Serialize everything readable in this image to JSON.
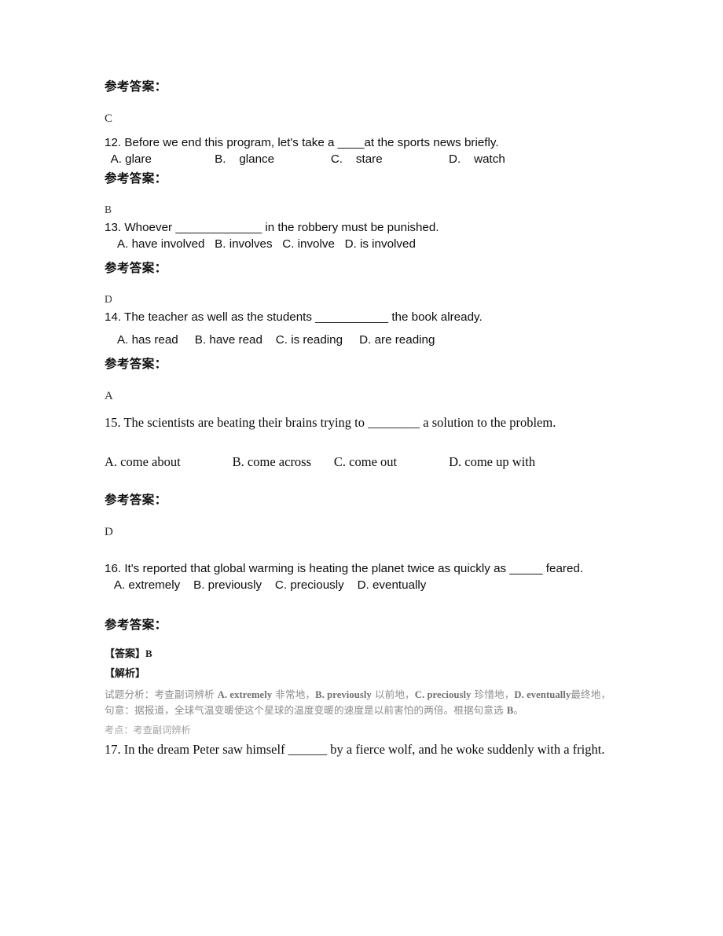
{
  "document": {
    "answer_heading": "参考答案：",
    "blocks": [
      {
        "kind": "answer_heading",
        "text": "参考答案："
      },
      {
        "kind": "answer_letter",
        "text": "C"
      },
      {
        "kind": "question_sans",
        "number": "12.",
        "text": "12. Before we end this program, let's take a ____at the sports news briefly.",
        "options": "  A. glare                   B.    glance                 C.    stare                    D.    watch"
      },
      {
        "kind": "answer_heading",
        "text": "参考答案："
      },
      {
        "kind": "answer_letter_small",
        "text": "B"
      },
      {
        "kind": "question_sans",
        "number": "13.",
        "text": "13. Whoever _____________ in the robbery must be punished.",
        "options": "    A. have involved   B. involves   C. involve   D. is involved"
      },
      {
        "kind": "answer_heading",
        "text": "参考答案："
      },
      {
        "kind": "answer_letter_small",
        "text": "D"
      },
      {
        "kind": "question_sans",
        "number": "14.",
        "text": "  14. The teacher as well as the students ___________ the book already.",
        "options": "    A. has read     B. have read    C. is reading     D. are reading"
      },
      {
        "kind": "answer_heading",
        "text": "参考答案："
      },
      {
        "kind": "answer_letter",
        "text": "A"
      },
      {
        "kind": "question_serif",
        "number": "15.",
        "text": "15. The scientists are beating their brains trying to ________ a solution to the problem.",
        "options": "A. come about                B. come across       C. come out                D. come up with"
      },
      {
        "kind": "answer_heading",
        "text": "参考答案："
      },
      {
        "kind": "answer_letter",
        "text": "D"
      },
      {
        "kind": "question_sans_justified",
        "number": "16.",
        "text": "16. It's reported that global warming is heating the planet twice as quickly as _____ feared.",
        "options": "   A. extremely    B. previously    C. preciously    D. eventually"
      },
      {
        "kind": "answer_heading",
        "text": "参考答案："
      },
      {
        "kind": "explanation_answer",
        "label": "【答案】",
        "value": "B"
      },
      {
        "kind": "explanation_label",
        "label": "【解析】"
      },
      {
        "kind": "explanation_body",
        "line1_pre": "试题分析：考查副词辨析 ",
        "line1_a": "A. extremely",
        "line1_a_cn": " 非常地，",
        "line1_b": "B. previously",
        "line1_b_cn": " 以前地，",
        "line1_c": "C. preciously",
        "line1_c_cn": " 珍惜地，",
        "line1_d": "D. eventually",
        "line2": "最终地，句意：据报道，全球气温变暖使这个星球的温度变暖的速度是以前害怕的两倍。根据句意选 ",
        "line2_end": "B",
        "line2_punct": "。"
      },
      {
        "kind": "explanation_point",
        "text": "考点：考查副词辨析"
      },
      {
        "kind": "question_serif_justified",
        "number": "17.",
        "text": "17. In the dream Peter saw himself ______ by a fierce wolf, and he woke suddenly with a fright."
      }
    ]
  },
  "q12": {
    "stem": "12. Before we end this program, let's take a ____at the sports news briefly.",
    "options": "  A. glare                   B.    glance                 C.    stare                    D.    watch"
  },
  "q13": {
    "stem": "13. Whoever _____________ in the robbery must be punished.",
    "options": "    A. have involved   B. involves   C. involve   D. is involved"
  },
  "q14": {
    "stem": "  14. The teacher as well as the students ___________ the book already.",
    "options": "    A. has read     B. have read    C. is reading     D. are reading"
  },
  "q15": {
    "stem": "15. The scientists are beating their brains trying to ________ a solution to the problem.",
    "options": "A. come about                B. come across       C. come out                D. come up with"
  },
  "q16": {
    "stem": "16. It's reported that global warming is heating the planet twice as quickly as _____ feared.",
    "options": "   A. extremely    B. previously    C. preciously    D. eventually"
  },
  "q17": {
    "stem": "17. In the dream Peter saw himself ______ by a fierce wolf, and he woke suddenly with a fright."
  },
  "answers": {
    "a11": "C",
    "a12": "B",
    "a13": "D",
    "a14": "A",
    "a15": "D"
  },
  "headings": {
    "ref_answer": "参考答案："
  },
  "explanation": {
    "answer_label": "【答案】",
    "answer_value": "B",
    "analysis_label": "【解析】",
    "line1_pre": "试题分析：考查副词辨析 ",
    "line1_a": "A. extremely",
    "line1_a_cn": " 非常地，",
    "line1_b": "B. previously",
    "line1_b_cn": " 以前地，",
    "line1_c": "C. preciously",
    "line1_c_cn": " 珍惜地，",
    "line1_d": "D. eventually",
    "line2_cn": "最终地，句意：据报道，全球气温变暖使这个星球的温度变暖的速度是以前害怕的两倍。根据句意选 ",
    "line2_answer": "B",
    "line2_punct": "。",
    "point": "考点：考查副词辨析"
  },
  "colors": {
    "text": "#0d0d0d",
    "faded": "#8d8d8d",
    "faded_light": "#a2a2a2",
    "background": "#ffffff"
  }
}
